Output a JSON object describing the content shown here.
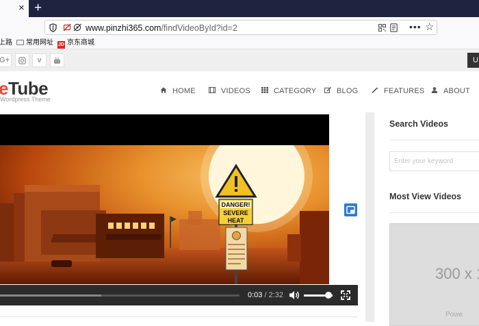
{
  "browser": {
    "tab_close": "×",
    "new_tab": "+",
    "url_host": "www.pinzhi365.com",
    "url_path": "/findVideoById?id=2",
    "more": "•••",
    "star": "☆"
  },
  "bookmarks": [
    {
      "label": "上路"
    },
    {
      "label": "常用网址"
    },
    {
      "label": "京东商城",
      "badge": "JD"
    }
  ],
  "social": {
    "google": "G+",
    "vimeo": "v",
    "button_label": "U"
  },
  "site": {
    "logo_red": "e",
    "logo_text": "Tube",
    "logo_sub": "Wordpress Theme"
  },
  "nav": [
    {
      "label": "HOME",
      "icon": "home-icon"
    },
    {
      "label": "VIDEOS",
      "icon": "film-icon"
    },
    {
      "label": "CATEGORY",
      "icon": "grid-icon"
    },
    {
      "label": "BLOG",
      "icon": "edit-icon"
    },
    {
      "label": "FEATURES",
      "icon": "magic-wand-icon"
    },
    {
      "label": "ABOUT",
      "icon": "user-icon"
    }
  ],
  "video": {
    "sign_line1": "DANGER!",
    "sign_line2": "SEVERE",
    "sign_line3": "HEAT",
    "current_time": "0:03",
    "separator": " / ",
    "duration": "2:32",
    "progress_fraction": 0.02,
    "volume_fraction": 0.85
  },
  "sidebar": {
    "search_title": "Search Videos",
    "search_placeholder": "Enter your keyword",
    "most_view_title": "Most View Videos",
    "ad_size": "300 x 1",
    "ad_powered": "Powe"
  },
  "colors": {
    "tabbar": "#202340",
    "accent_red": "#e74c3c",
    "float_button": "#2d7ad6"
  }
}
